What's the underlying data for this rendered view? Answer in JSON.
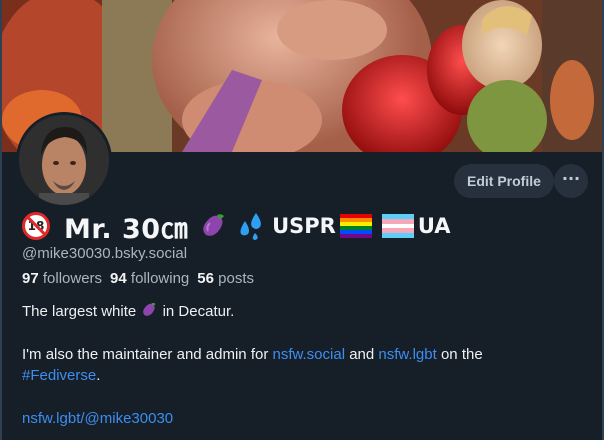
{
  "profile": {
    "display_name_part1": "Mr. 30㎝",
    "display_name_part2": "USPR",
    "display_name_part3": "UA",
    "handle": "@mike30030.bsky.social",
    "stats": {
      "followers_count": "97",
      "followers_label": "followers",
      "following_count": "94",
      "following_label": "following",
      "posts_count": "56",
      "posts_label": "posts"
    },
    "bio": {
      "line1_before": "The largest white",
      "line1_after": "in Decatur.",
      "line2_before": "I'm also the maintainer and admin for",
      "link1": "nsfw.social",
      "line2_mid": "and",
      "link2": "nsfw.lgbt",
      "line2_after": "on the",
      "hashtag": "#Fediverse",
      "line3_after": ".",
      "profile_link": "nsfw.lgbt/@mike30030"
    }
  },
  "actions": {
    "edit_profile_label": "Edit Profile",
    "more_label": "···"
  },
  "badge": {
    "no18_label": "18"
  },
  "icons": {
    "no18": "no-under-18-icon",
    "eggplant": "eggplant-emoji-icon",
    "droplets": "sweat-droplets-emoji-icon",
    "rainbow_flag": "rainbow-flag-icon",
    "trans_flag": "transgender-flag-icon"
  },
  "colors": {
    "background": "#161e27",
    "link": "#3d8ef0",
    "button_bg": "#26313d",
    "muted_text": "#aab5c1"
  }
}
